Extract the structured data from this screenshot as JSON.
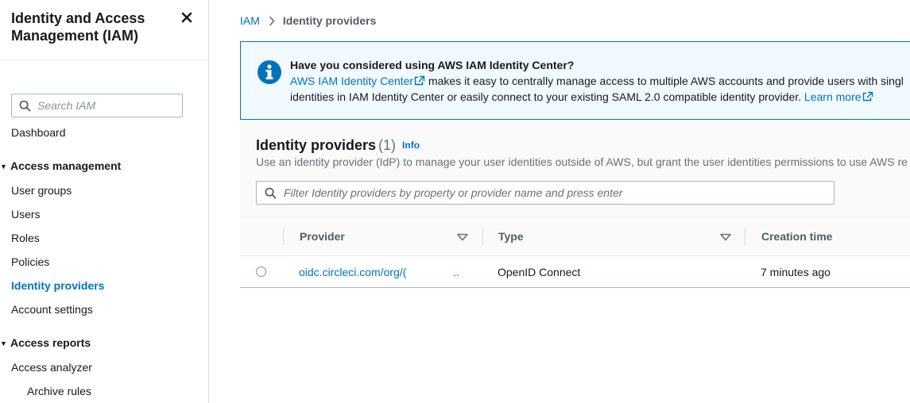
{
  "sidebar": {
    "title": "Identity and Access Management (IAM)",
    "search_placeholder": "Search IAM",
    "dashboard": "Dashboard",
    "section_access_management": "Access management",
    "items_access_management": [
      "User groups",
      "Users",
      "Roles",
      "Policies",
      "Identity providers",
      "Account settings"
    ],
    "active_item": "Identity providers",
    "section_access_reports": "Access reports",
    "access_analyzer": "Access analyzer",
    "archive_rules": "Archive rules"
  },
  "breadcrumb": {
    "root": "IAM",
    "current": "Identity providers"
  },
  "alert": {
    "title": "Have you considered using AWS IAM Identity Center?",
    "link1": "AWS IAM Identity Center",
    "line1_rest": "makes it easy to centrally manage access to multiple AWS accounts and provide users with singl",
    "line2": "identities in IAM Identity Center or easily connect to your existing SAML 2.0 compatible identity provider.",
    "learn_more": "Learn more"
  },
  "table": {
    "title": "Identity providers",
    "count": "(1)",
    "info": "Info",
    "description": "Use an identity provider (IdP) to manage your user identities outside of AWS, but grant the user identities permissions to use AWS re",
    "filter_placeholder": "Filter Identity providers by property or provider name and press enter",
    "columns": [
      "Provider",
      "Type",
      "Creation time"
    ],
    "rows": [
      {
        "provider": "oidc.circleci.com/org/(",
        "truncation": "..",
        "type": "OpenID Connect",
        "created": "7 minutes ago"
      }
    ]
  },
  "colors": {
    "link": "#0073bb",
    "alert_bg": "#f1faff",
    "alert_border": "#0073bb",
    "text": "#16191f",
    "muted": "#687078"
  }
}
